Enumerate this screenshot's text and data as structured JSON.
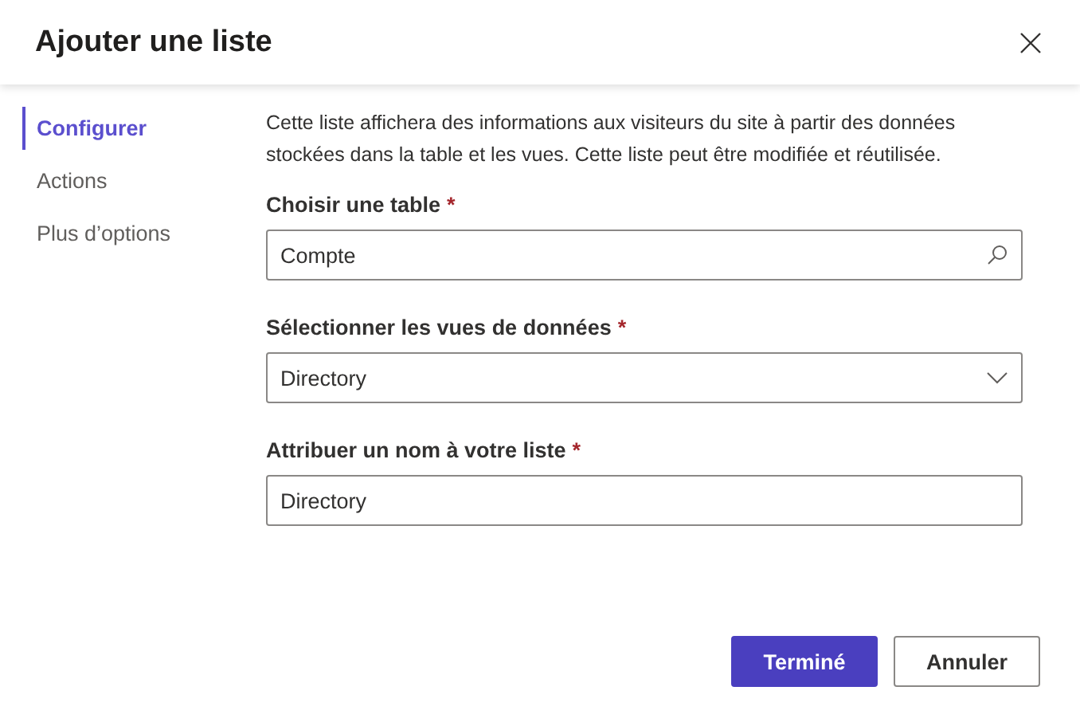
{
  "dialog": {
    "title": "Ajouter une liste"
  },
  "nav": [
    {
      "label": "Configurer",
      "selected": true
    },
    {
      "label": "Actions",
      "selected": false
    },
    {
      "label": "Plus d’options",
      "selected": false
    }
  ],
  "description": "Cette liste affichera des informations aux visiteurs du site à partir des données stockées dans la table et les vues. Cette liste peut être modifiée et réutilisée.",
  "fields": [
    {
      "kind": "search",
      "label": "Choisir une table",
      "required_mark": "*",
      "value": "Compte"
    },
    {
      "kind": "select",
      "label": "Sélectionner les vues de données",
      "required_mark": "*",
      "value": "Directory"
    },
    {
      "kind": "text",
      "label": "Attribuer un nom à votre liste",
      "required_mark": "*",
      "value": "Directory"
    }
  ],
  "buttons": [
    {
      "label": "Terminé",
      "primary": true
    },
    {
      "label": "Annuler",
      "primary": false
    }
  ]
}
